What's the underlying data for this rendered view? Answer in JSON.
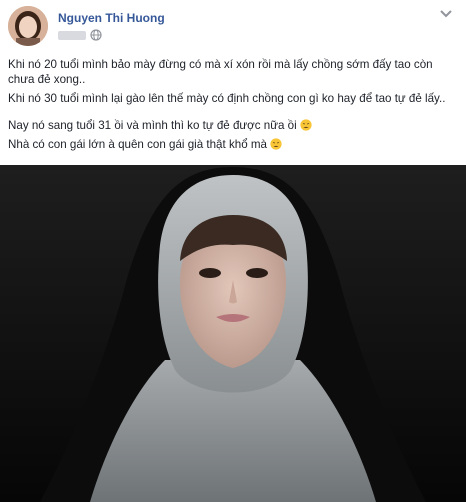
{
  "post": {
    "author": "Nguyen Thi Huong",
    "lines": [
      "Khi nó 20 tuổi mình bảo mày đừng có mà xí xón rồi mà lấy chồng sớm đấy tao còn chưa đẻ xong..",
      "Khi nó 30 tuổi mình lại gào lên thế mày có định chồng con gì ko hay để tao tự đẻ lấy..",
      "Nay nó sang tuổi 31 ồi và mình thì ko tự đẻ được nữa ồi",
      "Nhà có con gái lớn à quên con gái già thật khổ mà"
    ],
    "emoji_icon": "weary-face-emoji",
    "privacy_icon": "globe-icon",
    "options_icon": "chevron-down-icon"
  },
  "colors": {
    "author_link": "#365899",
    "text": "#1d2129"
  }
}
